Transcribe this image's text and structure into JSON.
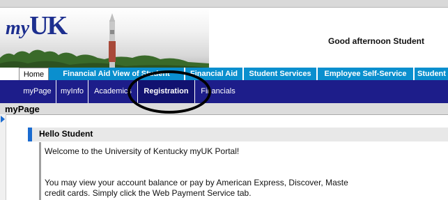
{
  "header": {
    "logo_my": "my",
    "logo_uk": "UK",
    "greeting": "Good afternoon Student"
  },
  "primary_tabs": [
    {
      "label": "Home",
      "active": true
    },
    {
      "label": "Financial Aid View of Student",
      "active": false
    },
    {
      "label": "Financial Aid",
      "active": false
    },
    {
      "label": "Student Services",
      "active": false
    },
    {
      "label": "Employee Self-Service",
      "active": false
    },
    {
      "label": "Student",
      "active": false
    }
  ],
  "secondary_tabs": [
    {
      "label": "myPage",
      "active": false
    },
    {
      "label": "myInfo",
      "active": false
    },
    {
      "label": "Academics",
      "active": false
    },
    {
      "label": "Registration",
      "active": true
    },
    {
      "label": "Financials",
      "active": false
    }
  ],
  "page": {
    "title": "myPage"
  },
  "portlet": {
    "title": "Hello Student",
    "line1": "Welcome to the University of Kentucky myUK Portal!",
    "line2": "You may view your account balance or pay by American Express, Discover, Maste",
    "line3": "credit cards. Simply click the Web Payment Service tab."
  },
  "colors": {
    "primary_tab": "#0a8fce",
    "secondary_bar": "#1d1d8a",
    "logo": "#1d2f8f",
    "accent": "#1a6bd0"
  }
}
